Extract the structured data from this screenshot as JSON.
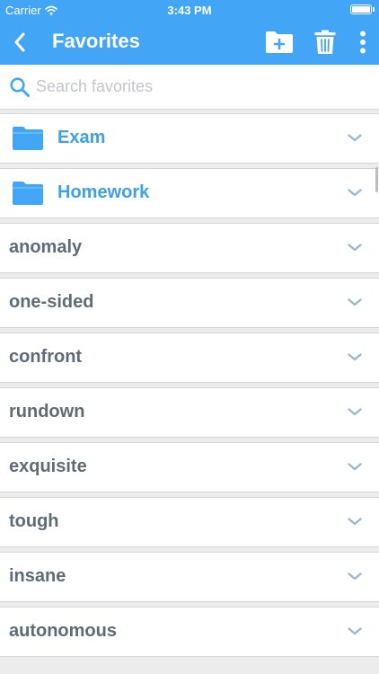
{
  "status_bar": {
    "carrier": "Carrier",
    "time": "3:43 PM"
  },
  "header": {
    "title": "Favorites"
  },
  "search": {
    "placeholder": "Search favorites"
  },
  "folders": [
    {
      "label": "Exam"
    },
    {
      "label": "Homework"
    }
  ],
  "words": [
    {
      "label": "anomaly"
    },
    {
      "label": "one-sided"
    },
    {
      "label": "confront"
    },
    {
      "label": "rundown"
    },
    {
      "label": "exquisite"
    },
    {
      "label": "tough"
    },
    {
      "label": "insane"
    },
    {
      "label": "autonomous"
    }
  ],
  "colors": {
    "accent": "#42a5f5",
    "folder_text": "#3ea0e6",
    "word_text": "#5f6b77",
    "chevron": "#9db8cc",
    "background": "#ececec"
  },
  "icons": {
    "back": "back-arrow-icon",
    "new_folder": "new-folder-icon",
    "delete": "trash-icon",
    "more": "more-vertical-icon",
    "search": "search-icon",
    "folder": "folder-icon",
    "expand": "chevron-down-icon"
  }
}
